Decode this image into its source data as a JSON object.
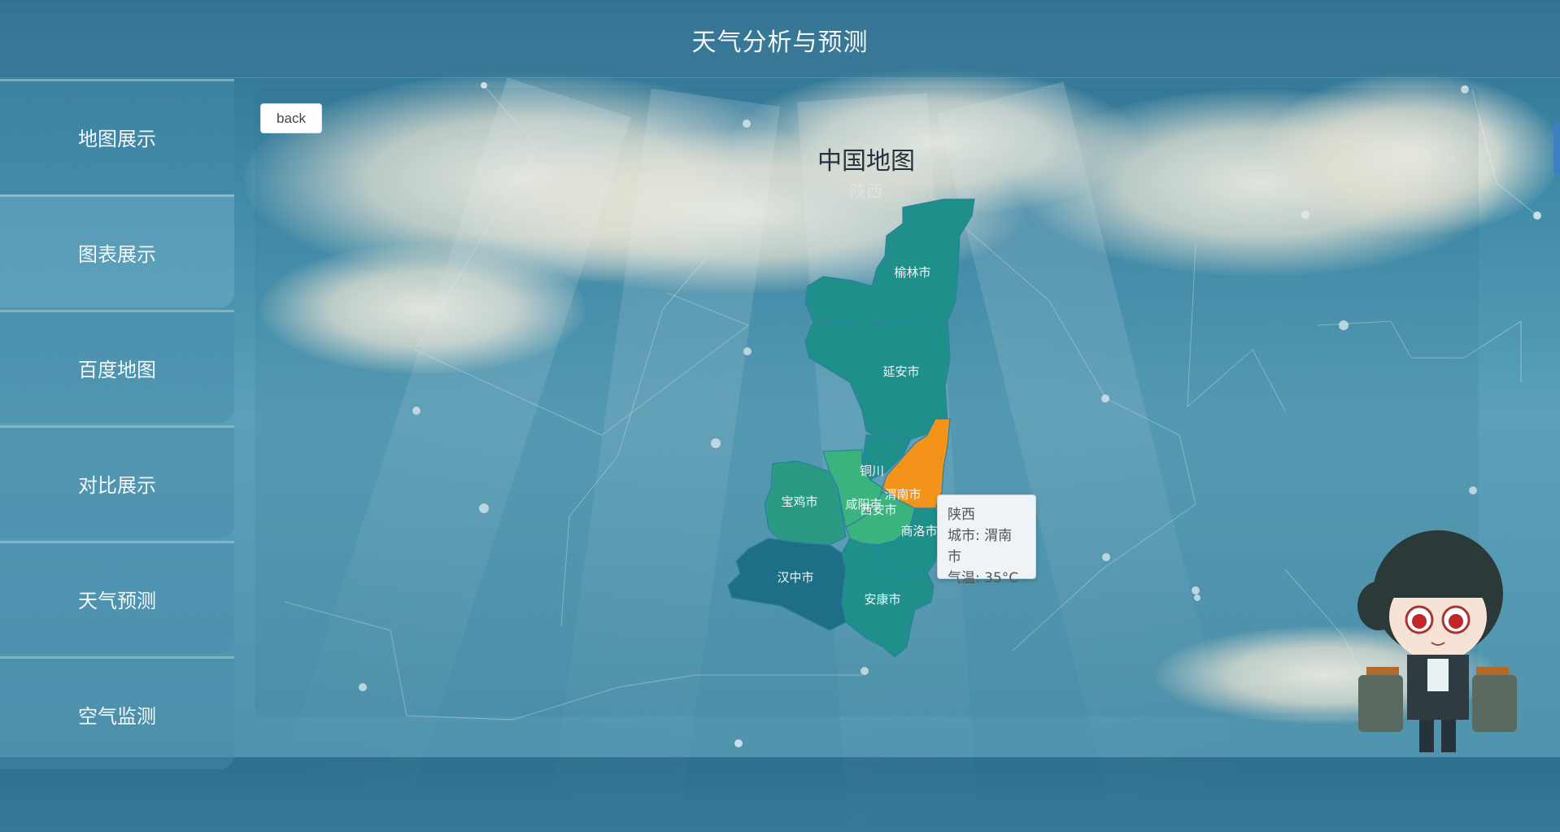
{
  "header": {
    "title": "天气分析与预测"
  },
  "sidebar": {
    "items": [
      {
        "label": "地图展示"
      },
      {
        "label": "图表展示"
      },
      {
        "label": "百度地图"
      },
      {
        "label": "对比展示"
      },
      {
        "label": "天气预测"
      },
      {
        "label": "空气监测"
      }
    ]
  },
  "content": {
    "back_label": "back",
    "map_title": "中国地图",
    "map_subtitle": "陕西",
    "cities": [
      {
        "name": "榆林市"
      },
      {
        "name": "延安市"
      },
      {
        "name": "铜川"
      },
      {
        "name": "渭南市"
      },
      {
        "name": "宝鸡市"
      },
      {
        "name": "咸阳市"
      },
      {
        "name": "西安市"
      },
      {
        "name": "商洛市"
      },
      {
        "name": "汉中市"
      },
      {
        "name": "安康市"
      }
    ],
    "tooltip": {
      "province": "陕西",
      "city_line": "城市: 渭南市",
      "temp_line": "气温: 35°C"
    }
  },
  "colors": {
    "map_dark": "#1f8f8a",
    "map_mid": "#2a9a82",
    "map_light": "#3bb37f",
    "map_deep": "#1e6f86",
    "highlight": "#f39319"
  }
}
